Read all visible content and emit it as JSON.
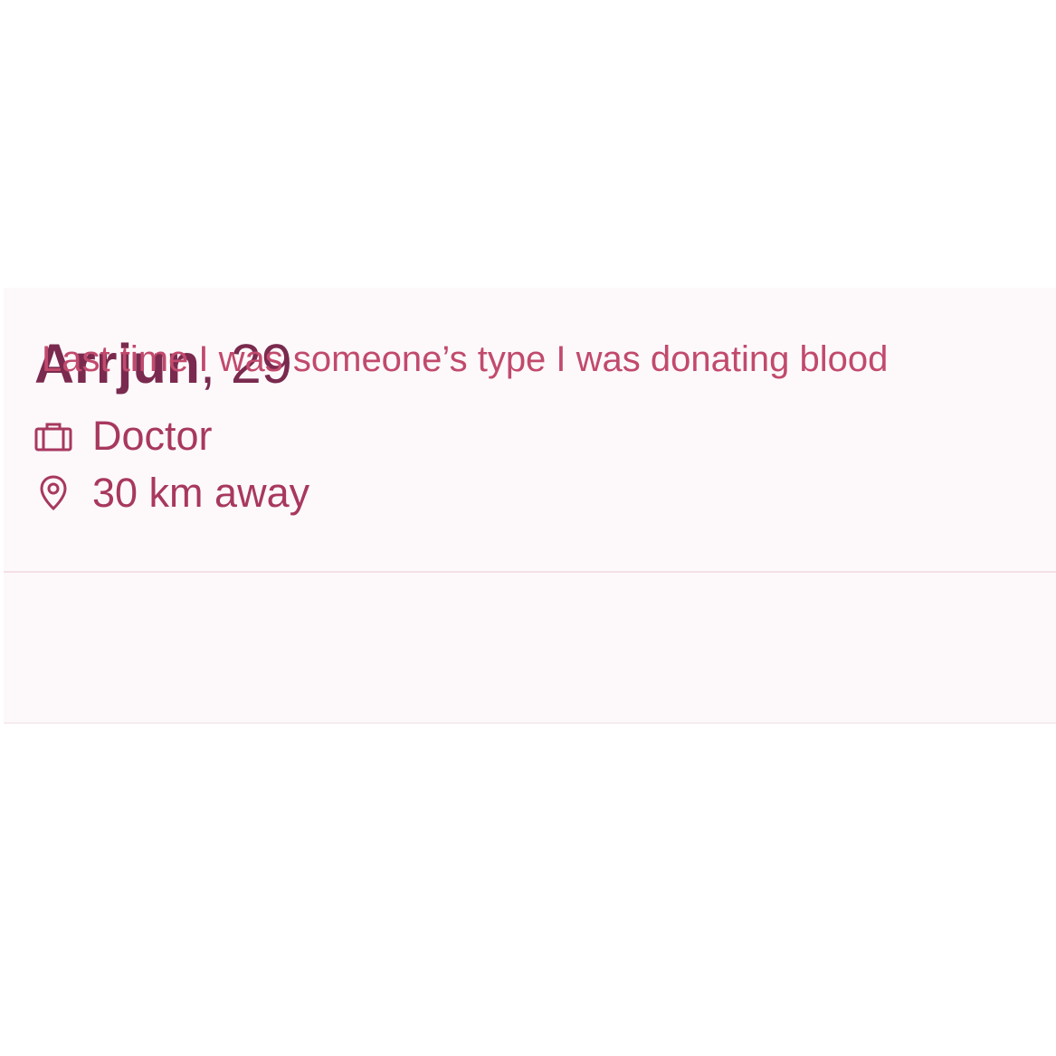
{
  "profile": {
    "name": "Arrjun",
    "age_text": ", 29",
    "job": {
      "icon": "briefcase-icon",
      "label": "Doctor"
    },
    "distance": {
      "icon": "location-pin-icon",
      "label": "30 km away"
    },
    "bio": "Last time I was someone’s type I was donating blood"
  },
  "colors": {
    "name": "#7a2a4e",
    "info_text": "#a8385f",
    "bio_text": "#c14a6d",
    "card_background": "#fdf9fb",
    "divider": "#f3dfe7"
  }
}
